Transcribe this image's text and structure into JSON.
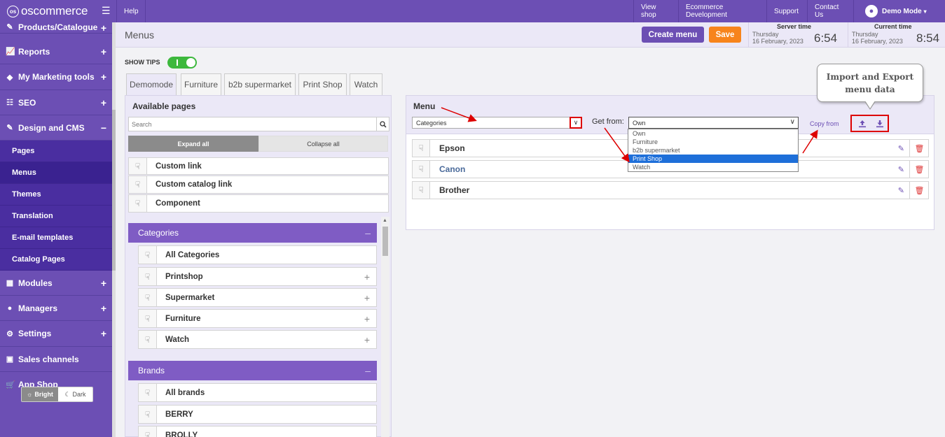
{
  "topbar": {
    "logo_text": "oscommerce",
    "help": "Help",
    "view_shop": "View shop",
    "ecommerce_dev": "Ecommerce Development",
    "support": "Support",
    "contact_us": "Contact Us",
    "demo_mode": "Demo Mode"
  },
  "sidebar": {
    "items": [
      {
        "label": "Products/Catalogue",
        "sign": "+"
      },
      {
        "label": "Reports",
        "sign": "+"
      },
      {
        "label": "My Marketing tools",
        "sign": "+"
      },
      {
        "label": "SEO",
        "sign": "+"
      },
      {
        "label": "Design and CMS",
        "sign": "−"
      },
      {
        "label": "Modules",
        "sign": "+"
      },
      {
        "label": "Managers",
        "sign": "+"
      },
      {
        "label": "Settings",
        "sign": "+"
      },
      {
        "label": "Sales channels",
        "sign": ""
      },
      {
        "label": "App Shop",
        "sign": ""
      }
    ],
    "subitems": [
      "Pages",
      "Menus",
      "Themes",
      "Translation",
      "E-mail templates",
      "Catalog Pages"
    ],
    "active_subitem": "Menus",
    "theme_bright": "Bright",
    "theme_dark": "Dark"
  },
  "header": {
    "title": "Menus",
    "create_menu": "Create menu",
    "save": "Save",
    "server_time_label": "Server time",
    "server_day": "Thursday",
    "server_date": "16 February, 2023",
    "server_time": "6:54",
    "current_time_label": "Current time",
    "current_day": "Thursday",
    "current_date": "16 February, 2023",
    "current_time": "8:54"
  },
  "show_tips": {
    "label": "SHOW TIPS",
    "on": true
  },
  "tabs": [
    "Demomode",
    "Furniture",
    "b2b supermarket",
    "Print Shop",
    "Watch"
  ],
  "left_panel": {
    "title": "Available pages",
    "search_placeholder": "Search",
    "expand_all": "Expand all",
    "collapse_all": "Collapse all",
    "links": [
      "Custom link",
      "Custom catalog link",
      "Component"
    ],
    "categories": {
      "header": "Categories",
      "items": [
        {
          "label": "All Categories",
          "plus": ""
        },
        {
          "label": "Printshop",
          "plus": "+"
        },
        {
          "label": "Supermarket",
          "plus": "+"
        },
        {
          "label": "Furniture",
          "plus": "+"
        },
        {
          "label": "Watch",
          "plus": "+"
        }
      ]
    },
    "brands": {
      "header": "Brands",
      "items": [
        "All brands",
        "BERRY",
        "BROLLY"
      ]
    }
  },
  "right_panel": {
    "menu_label": "Menu",
    "menu_select_value": "Categories",
    "get_from_label": "Get from:",
    "get_from_value": "Own",
    "get_from_options": [
      "Own",
      "Furniture",
      "b2b supermarket",
      "Print Shop",
      "Watch"
    ],
    "get_from_highlighted": "Print Shop",
    "copy_from": "Copy from",
    "menu_items": [
      {
        "label": "Epson",
        "style": "normal"
      },
      {
        "label": "Canon",
        "style": "link"
      },
      {
        "label": "Brother",
        "style": "normal"
      }
    ]
  },
  "tooltip": {
    "line1": "Import and Export",
    "line2": "menu data"
  },
  "colors": {
    "brand_purple": "#6c4fb4",
    "save_orange": "#f7841c",
    "toggle_green": "#3db83d",
    "annotation_red": "#dd0000"
  }
}
